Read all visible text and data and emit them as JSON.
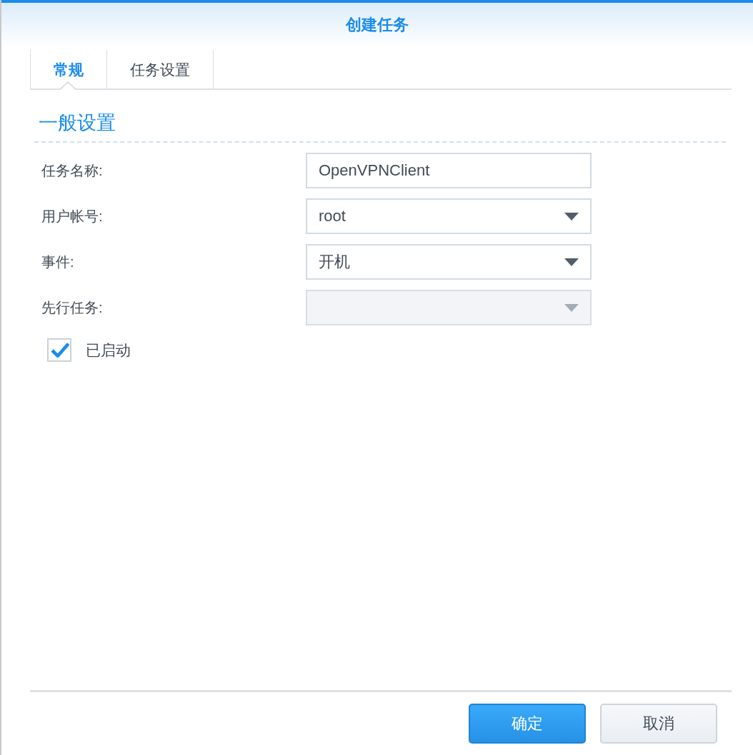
{
  "window": {
    "title": "创建任务"
  },
  "tabs": [
    {
      "label": "常规",
      "selected": true
    },
    {
      "label": "任务设置",
      "selected": false
    }
  ],
  "section": {
    "title": "一般设置"
  },
  "fields": [
    {
      "label": "任务名称:",
      "kind": "text",
      "value": "OpenVPNClient",
      "disabled": false
    },
    {
      "label": "用户帐号:",
      "kind": "select",
      "value": "root",
      "disabled": false
    },
    {
      "label": "事件:",
      "kind": "select",
      "value": "开机",
      "disabled": false
    },
    {
      "label": "先行任务:",
      "kind": "select",
      "disabled": true
    }
  ],
  "enabled_checkbox": {
    "label": "已启动",
    "checked": true
  },
  "buttons": [
    {
      "label": "确定",
      "kind": "primary"
    },
    {
      "label": "取消",
      "kind": "secondary"
    }
  ]
}
